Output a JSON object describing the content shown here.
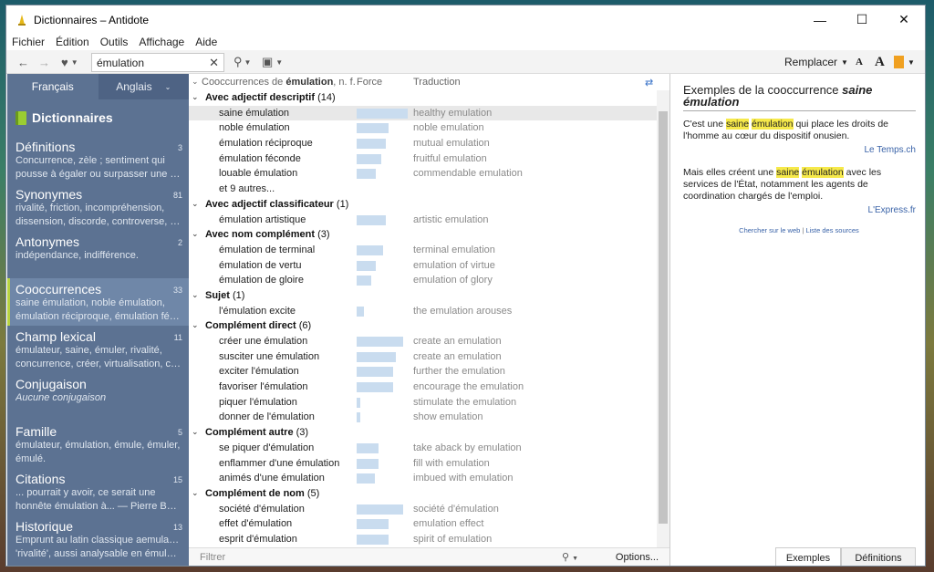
{
  "window": {
    "title": "Dictionnaires – Antidote"
  },
  "menu": [
    "Fichier",
    "Édition",
    "Outils",
    "Affichage",
    "Aide"
  ],
  "toolbar": {
    "search_value": "émulation",
    "replace_label": "Remplacer",
    "font_small": "A",
    "font_large": "A",
    "accent": "#f0a020"
  },
  "sidebar": {
    "lang_fr": "Français",
    "lang_en": "Anglais",
    "header": "Dictionnaires",
    "sections": [
      {
        "title": "Définitions",
        "count": "3",
        "desc": "Concurrence, zèle ; sentiment qui",
        "desc2": "pousse à égaler ou surpasser une per..."
      },
      {
        "title": "Synonymes",
        "count": "81",
        "desc": "rivalité, friction, incompréhension,",
        "desc2": "dissension, discorde, controverse, ant..."
      },
      {
        "title": "Antonymes",
        "count": "2",
        "desc": "indépendance, indifférence.",
        "desc2": ""
      },
      {
        "title": "Cooccurrences",
        "count": "33",
        "desc": "saine émulation, noble émulation,",
        "desc2": "émulation réciproque, émulation féc..."
      },
      {
        "title": "Champ lexical",
        "count": "11",
        "desc": "émulateur, saine, émuler, rivalité,",
        "desc2": "concurrence, créer, virtualisation, co..."
      },
      {
        "title": "Conjugaison",
        "count": "",
        "desc": "Aucune conjugaison",
        "desc2": ""
      },
      {
        "title": "Famille",
        "count": "5",
        "desc": "émulateur, émulation, émule, émuler,",
        "desc2": "émulé."
      },
      {
        "title": "Citations",
        "count": "15",
        "desc": "... pourrait y avoir, ce serait une",
        "desc2": "honnête émulation à...  — Pierre Bayle"
      },
      {
        "title": "Historique",
        "count": "13",
        "desc": "Emprunt au latin classique aemulatio,",
        "desc2": "'rivalité', aussi analysable en émuler e..."
      }
    ]
  },
  "middle": {
    "col_cooc": "Cooccurrences de",
    "col_word": "émulation",
    "col_pos": ", n. f.",
    "col_force": "Force",
    "col_trad": "Traduction",
    "filter_placeholder": "Filtrer",
    "options": "Options...",
    "groups": [
      {
        "label": "Avec adjectif descriptif",
        "count": "(14)",
        "items": [
          {
            "term": "saine émulation",
            "force": 1.0,
            "trad": "healthy emulation",
            "sel": true
          },
          {
            "term": "noble émulation",
            "force": 0.62,
            "trad": "noble emulation"
          },
          {
            "term": "émulation réciproque",
            "force": 0.57,
            "trad": "mutual emulation"
          },
          {
            "term": "émulation féconde",
            "force": 0.48,
            "trad": "fruitful emulation"
          },
          {
            "term": "louable émulation",
            "force": 0.38,
            "trad": "commendable emulation"
          }
        ],
        "more": "et 9 autres..."
      },
      {
        "label": "Avec adjectif classificateur",
        "count": "(1)",
        "items": [
          {
            "term": "émulation artistique",
            "force": 0.57,
            "trad": "artistic emulation"
          }
        ]
      },
      {
        "label": "Avec nom complément",
        "count": "(3)",
        "items": [
          {
            "term": "émulation de terminal",
            "force": 0.52,
            "trad": "terminal emulation"
          },
          {
            "term": "émulation de vertu",
            "force": 0.38,
            "trad": "emulation of virtue"
          },
          {
            "term": "émulation de gloire",
            "force": 0.29,
            "trad": "emulation of glory"
          }
        ]
      },
      {
        "label": "Sujet",
        "count": "(1)",
        "items": [
          {
            "term": "l'émulation excite",
            "force": 0.14,
            "trad": "the emulation arouses"
          }
        ]
      },
      {
        "label": "Complément direct",
        "count": "(6)",
        "items": [
          {
            "term": "créer une émulation",
            "force": 0.91,
            "trad": "create an emulation"
          },
          {
            "term": "susciter une émulation",
            "force": 0.76,
            "trad": "create an emulation"
          },
          {
            "term": "exciter l'émulation",
            "force": 0.71,
            "trad": "further the emulation"
          },
          {
            "term": "favoriser l'émulation",
            "force": 0.71,
            "trad": "encourage the emulation"
          },
          {
            "term": "piquer l'émulation",
            "force": 0.07,
            "trad": "stimulate the emulation"
          },
          {
            "term": "donner de l'émulation",
            "force": 0.07,
            "trad": "show emulation"
          }
        ]
      },
      {
        "label": "Complément autre",
        "count": "(3)",
        "items": [
          {
            "term": "se piquer d'émulation",
            "force": 0.43,
            "trad": "take aback by emulation"
          },
          {
            "term": "enflammer d'une émulation",
            "force": 0.43,
            "trad": "fill with emulation"
          },
          {
            "term": "animés d'une émulation",
            "force": 0.36,
            "trad": "imbued with emulation"
          }
        ]
      },
      {
        "label": "Complément de nom",
        "count": "(5)",
        "items": [
          {
            "term": "société d'émulation",
            "force": 0.91,
            "trad": "société d'émulation"
          },
          {
            "term": "effet d'émulation",
            "force": 0.62,
            "trad": "emulation effect"
          },
          {
            "term": "esprit d'émulation",
            "force": 0.62,
            "trad": "spirit of emulation"
          }
        ]
      }
    ]
  },
  "right": {
    "title_pre": "Exemples de la cooccurrence",
    "title_term": "saine émulation",
    "ex1_a": "C'est une",
    "ex1_h1": "saine",
    "ex1_h2": "émulation",
    "ex1_b": "qui place les droits de l'homme au cœur du dispositif onusien.",
    "ex1_src": "Le Temps.ch",
    "ex2_a": "Mais elles créent une",
    "ex2_h1": "saine",
    "ex2_h2": "émulation",
    "ex2_b": "avec les services de l'État, notamment les agents de coordination chargés de l'emploi.",
    "ex2_src": "L'Express.fr",
    "link1": "Chercher sur le web",
    "link_sep": "|",
    "link2": "Liste des sources",
    "tab_ex": "Exemples",
    "tab_def": "Définitions"
  }
}
